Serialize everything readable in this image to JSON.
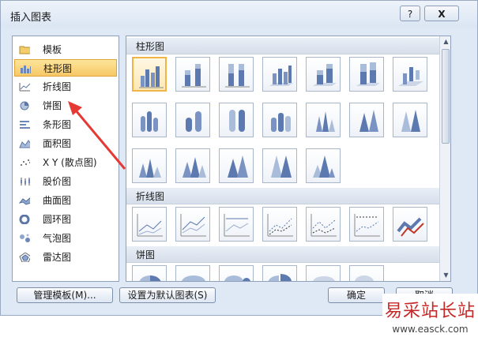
{
  "dialog": {
    "title": "插入图表",
    "help_label": "?",
    "close_label": "X"
  },
  "categories": [
    {
      "label": "模板",
      "icon": "folder-icon"
    },
    {
      "label": "柱形图",
      "icon": "column-chart-icon",
      "selected": true
    },
    {
      "label": "折线图",
      "icon": "line-chart-icon"
    },
    {
      "label": "饼图",
      "icon": "pie-chart-icon"
    },
    {
      "label": "条形图",
      "icon": "bar-chart-icon"
    },
    {
      "label": "面积图",
      "icon": "area-chart-icon"
    },
    {
      "label": "X Y (散点图)",
      "icon": "scatter-chart-icon"
    },
    {
      "label": "股价图",
      "icon": "stock-chart-icon"
    },
    {
      "label": "曲面图",
      "icon": "surface-chart-icon"
    },
    {
      "label": "圆环图",
      "icon": "doughnut-chart-icon"
    },
    {
      "label": "气泡图",
      "icon": "bubble-chart-icon"
    },
    {
      "label": "雷达图",
      "icon": "radar-chart-icon"
    }
  ],
  "sections": [
    {
      "title": "柱形图"
    },
    {
      "title": "折线图"
    },
    {
      "title": "饼图"
    }
  ],
  "buttons": {
    "manage_templates": "管理模板(M)...",
    "set_default": "设置为默认图表(S)",
    "ok": "确定",
    "cancel": "取消"
  },
  "watermark": {
    "text": "易采站长站",
    "url": "www.easck.com"
  }
}
